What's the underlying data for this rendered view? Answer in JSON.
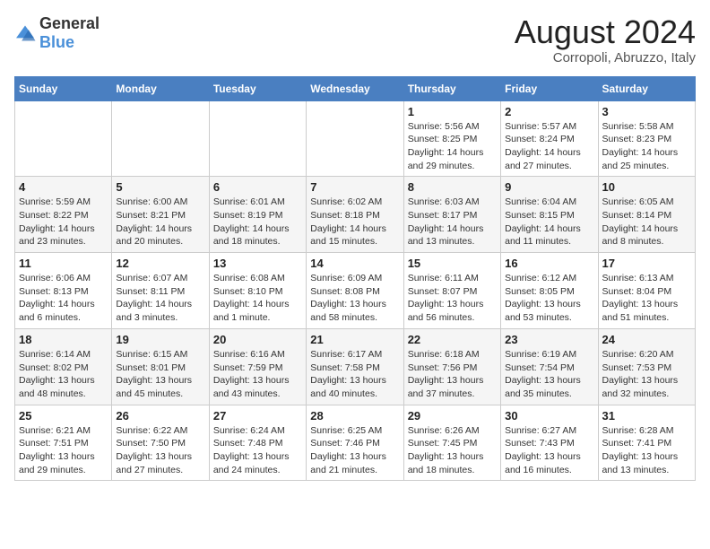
{
  "header": {
    "logo_general": "General",
    "logo_blue": "Blue",
    "title": "August 2024",
    "subtitle": "Corropoli, Abruzzo, Italy"
  },
  "weekdays": [
    "Sunday",
    "Monday",
    "Tuesday",
    "Wednesday",
    "Thursday",
    "Friday",
    "Saturday"
  ],
  "weeks": [
    [
      {
        "day": "",
        "info": ""
      },
      {
        "day": "",
        "info": ""
      },
      {
        "day": "",
        "info": ""
      },
      {
        "day": "",
        "info": ""
      },
      {
        "day": "1",
        "info": "Sunrise: 5:56 AM\nSunset: 8:25 PM\nDaylight: 14 hours and 29 minutes."
      },
      {
        "day": "2",
        "info": "Sunrise: 5:57 AM\nSunset: 8:24 PM\nDaylight: 14 hours and 27 minutes."
      },
      {
        "day": "3",
        "info": "Sunrise: 5:58 AM\nSunset: 8:23 PM\nDaylight: 14 hours and 25 minutes."
      }
    ],
    [
      {
        "day": "4",
        "info": "Sunrise: 5:59 AM\nSunset: 8:22 PM\nDaylight: 14 hours and 23 minutes."
      },
      {
        "day": "5",
        "info": "Sunrise: 6:00 AM\nSunset: 8:21 PM\nDaylight: 14 hours and 20 minutes."
      },
      {
        "day": "6",
        "info": "Sunrise: 6:01 AM\nSunset: 8:19 PM\nDaylight: 14 hours and 18 minutes."
      },
      {
        "day": "7",
        "info": "Sunrise: 6:02 AM\nSunset: 8:18 PM\nDaylight: 14 hours and 15 minutes."
      },
      {
        "day": "8",
        "info": "Sunrise: 6:03 AM\nSunset: 8:17 PM\nDaylight: 14 hours and 13 minutes."
      },
      {
        "day": "9",
        "info": "Sunrise: 6:04 AM\nSunset: 8:15 PM\nDaylight: 14 hours and 11 minutes."
      },
      {
        "day": "10",
        "info": "Sunrise: 6:05 AM\nSunset: 8:14 PM\nDaylight: 14 hours and 8 minutes."
      }
    ],
    [
      {
        "day": "11",
        "info": "Sunrise: 6:06 AM\nSunset: 8:13 PM\nDaylight: 14 hours and 6 minutes."
      },
      {
        "day": "12",
        "info": "Sunrise: 6:07 AM\nSunset: 8:11 PM\nDaylight: 14 hours and 3 minutes."
      },
      {
        "day": "13",
        "info": "Sunrise: 6:08 AM\nSunset: 8:10 PM\nDaylight: 14 hours and 1 minute."
      },
      {
        "day": "14",
        "info": "Sunrise: 6:09 AM\nSunset: 8:08 PM\nDaylight: 13 hours and 58 minutes."
      },
      {
        "day": "15",
        "info": "Sunrise: 6:11 AM\nSunset: 8:07 PM\nDaylight: 13 hours and 56 minutes."
      },
      {
        "day": "16",
        "info": "Sunrise: 6:12 AM\nSunset: 8:05 PM\nDaylight: 13 hours and 53 minutes."
      },
      {
        "day": "17",
        "info": "Sunrise: 6:13 AM\nSunset: 8:04 PM\nDaylight: 13 hours and 51 minutes."
      }
    ],
    [
      {
        "day": "18",
        "info": "Sunrise: 6:14 AM\nSunset: 8:02 PM\nDaylight: 13 hours and 48 minutes."
      },
      {
        "day": "19",
        "info": "Sunrise: 6:15 AM\nSunset: 8:01 PM\nDaylight: 13 hours and 45 minutes."
      },
      {
        "day": "20",
        "info": "Sunrise: 6:16 AM\nSunset: 7:59 PM\nDaylight: 13 hours and 43 minutes."
      },
      {
        "day": "21",
        "info": "Sunrise: 6:17 AM\nSunset: 7:58 PM\nDaylight: 13 hours and 40 minutes."
      },
      {
        "day": "22",
        "info": "Sunrise: 6:18 AM\nSunset: 7:56 PM\nDaylight: 13 hours and 37 minutes."
      },
      {
        "day": "23",
        "info": "Sunrise: 6:19 AM\nSunset: 7:54 PM\nDaylight: 13 hours and 35 minutes."
      },
      {
        "day": "24",
        "info": "Sunrise: 6:20 AM\nSunset: 7:53 PM\nDaylight: 13 hours and 32 minutes."
      }
    ],
    [
      {
        "day": "25",
        "info": "Sunrise: 6:21 AM\nSunset: 7:51 PM\nDaylight: 13 hours and 29 minutes."
      },
      {
        "day": "26",
        "info": "Sunrise: 6:22 AM\nSunset: 7:50 PM\nDaylight: 13 hours and 27 minutes."
      },
      {
        "day": "27",
        "info": "Sunrise: 6:24 AM\nSunset: 7:48 PM\nDaylight: 13 hours and 24 minutes."
      },
      {
        "day": "28",
        "info": "Sunrise: 6:25 AM\nSunset: 7:46 PM\nDaylight: 13 hours and 21 minutes."
      },
      {
        "day": "29",
        "info": "Sunrise: 6:26 AM\nSunset: 7:45 PM\nDaylight: 13 hours and 18 minutes."
      },
      {
        "day": "30",
        "info": "Sunrise: 6:27 AM\nSunset: 7:43 PM\nDaylight: 13 hours and 16 minutes."
      },
      {
        "day": "31",
        "info": "Sunrise: 6:28 AM\nSunset: 7:41 PM\nDaylight: 13 hours and 13 minutes."
      }
    ]
  ]
}
